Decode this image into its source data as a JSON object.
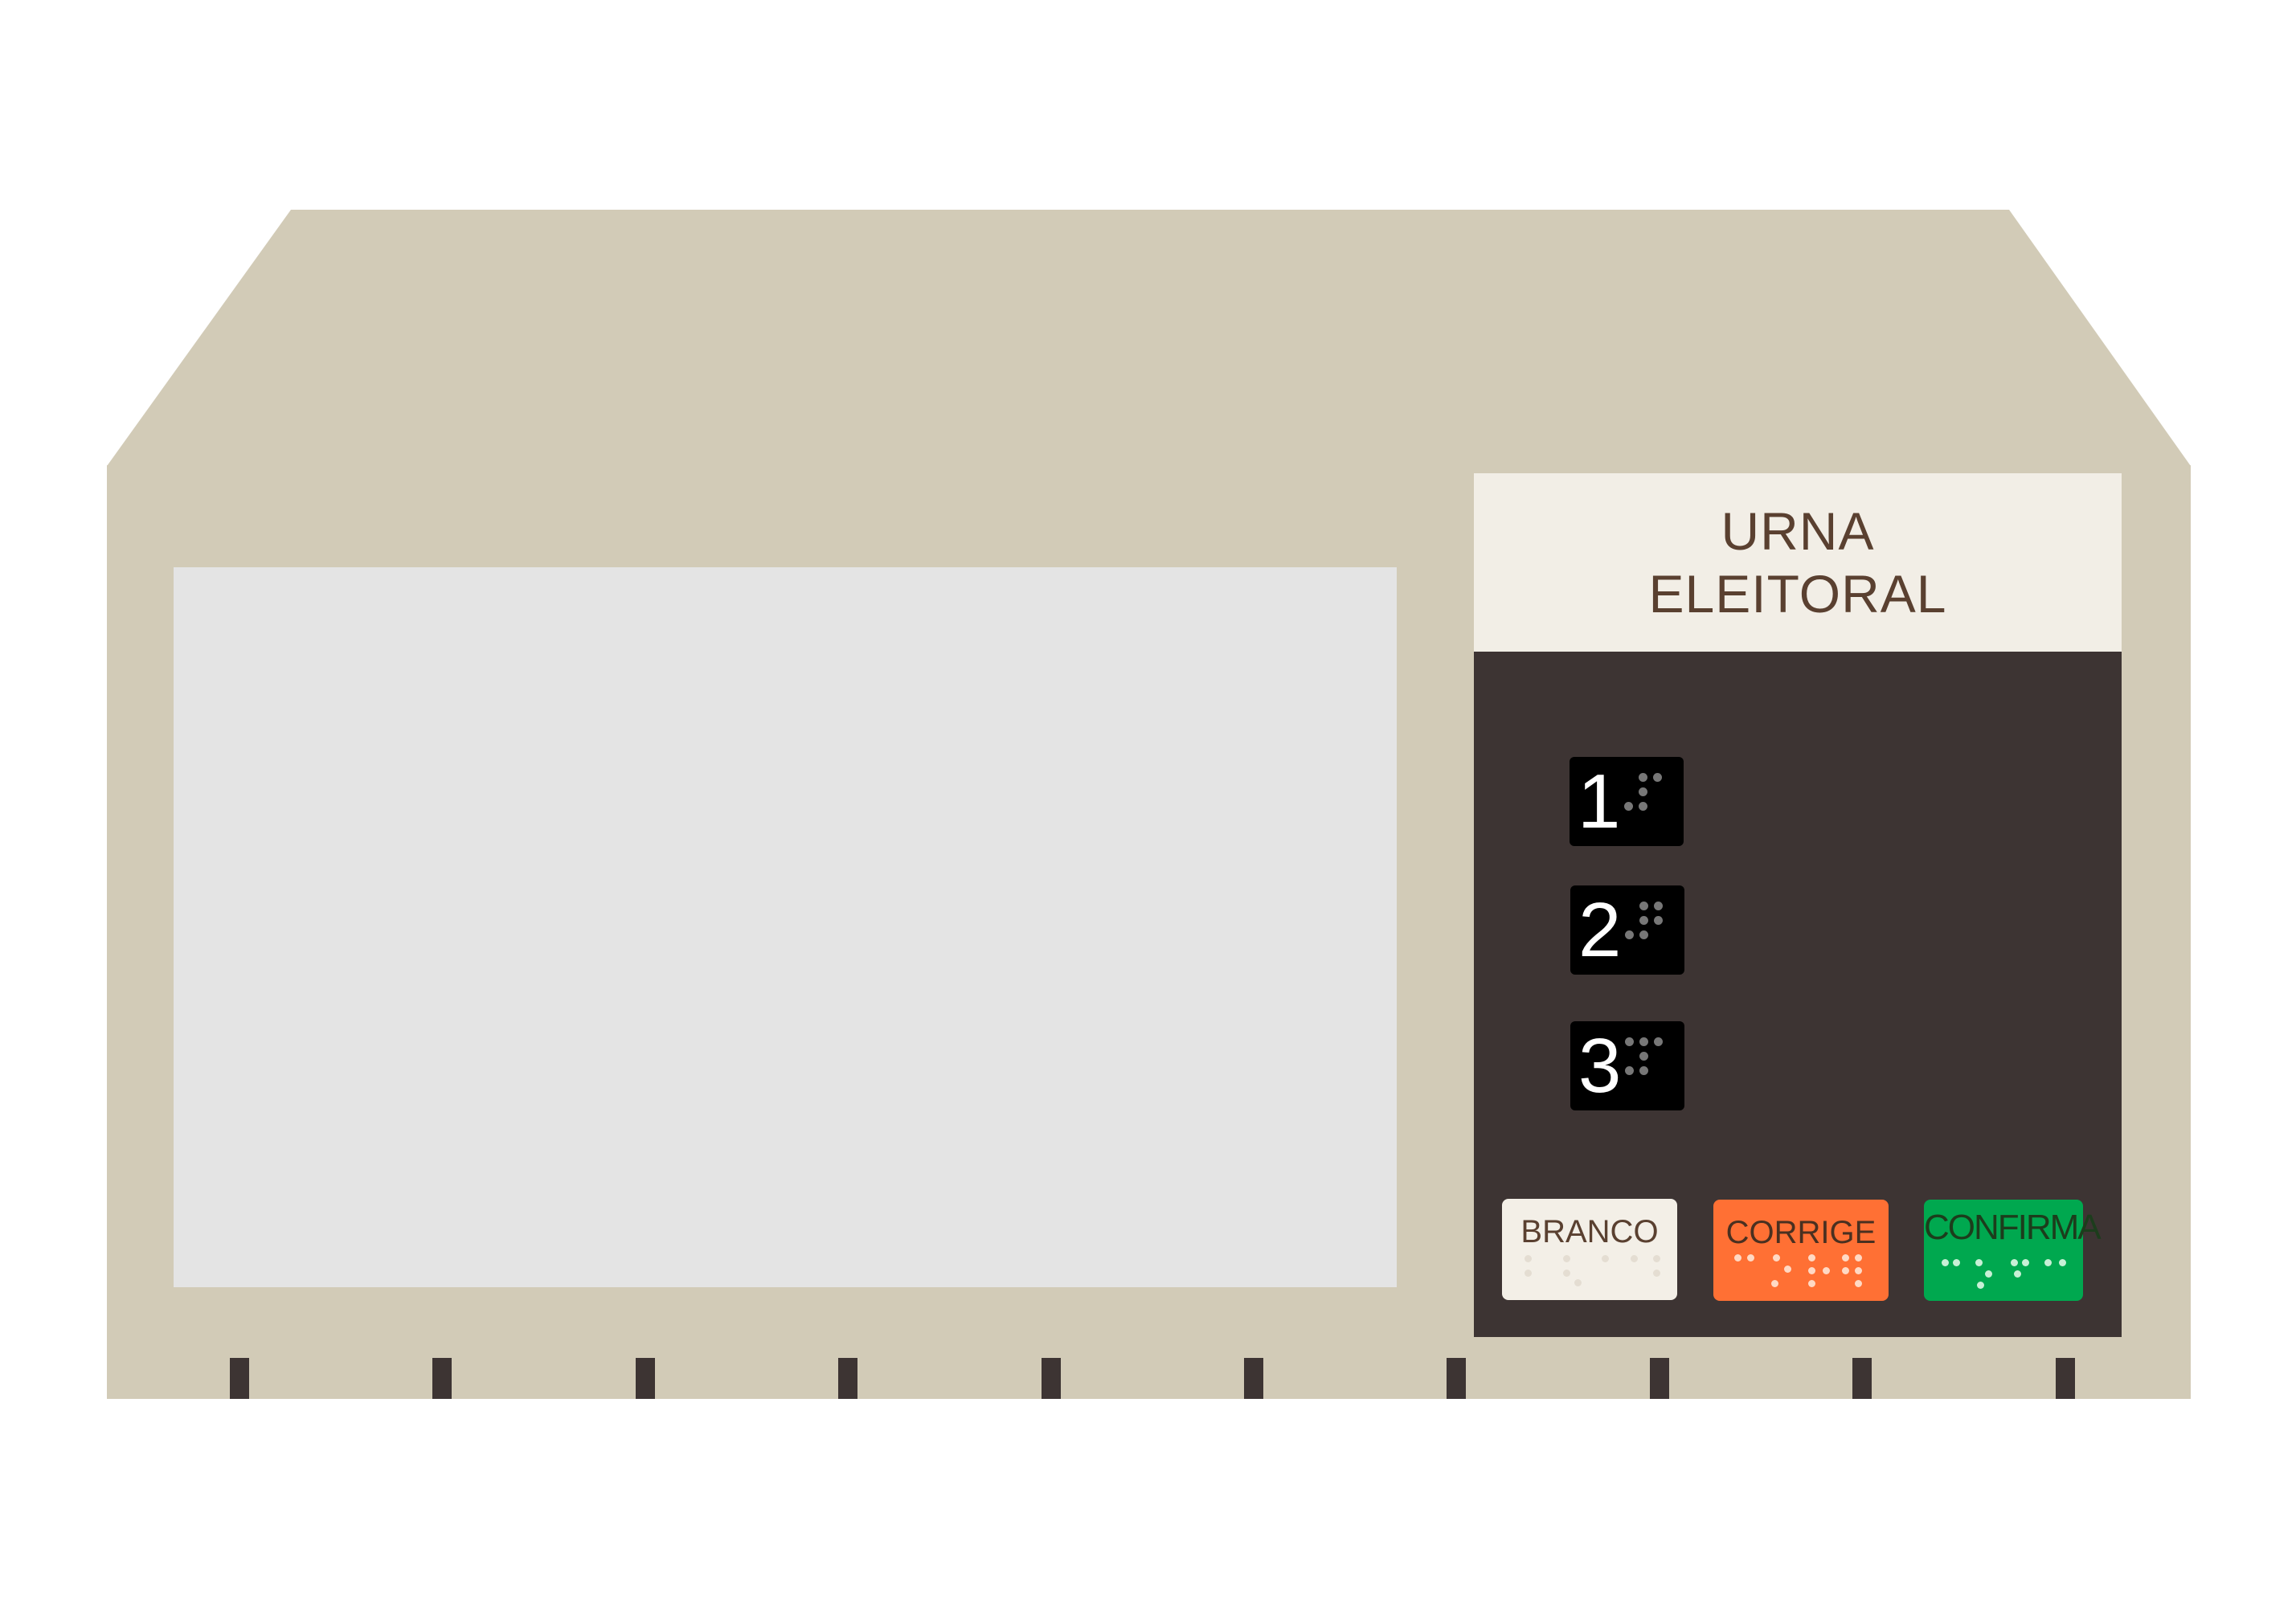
{
  "label": {
    "line1": "URNA",
    "line2": "ELEITORAL"
  },
  "keys": [
    {
      "digit": "1"
    },
    {
      "digit": "2"
    },
    {
      "digit": "3"
    }
  ],
  "actions": {
    "branco": {
      "label": "BRANCO",
      "color": "#f3efe7",
      "text_color": "#5a4030"
    },
    "corrige": {
      "label": "CORRIGE",
      "color": "#ff7034",
      "text_color": "#4a3020"
    },
    "confirma": {
      "label": "CONFIRMA",
      "color": "#00a84f",
      "text_color": "#1c3d1c"
    }
  },
  "colors": {
    "body": "#d2cbb7",
    "screen": "#e4e4e4",
    "keypad_panel": "#3d3433",
    "key": "#000000",
    "label_plate": "#f2eee6"
  }
}
